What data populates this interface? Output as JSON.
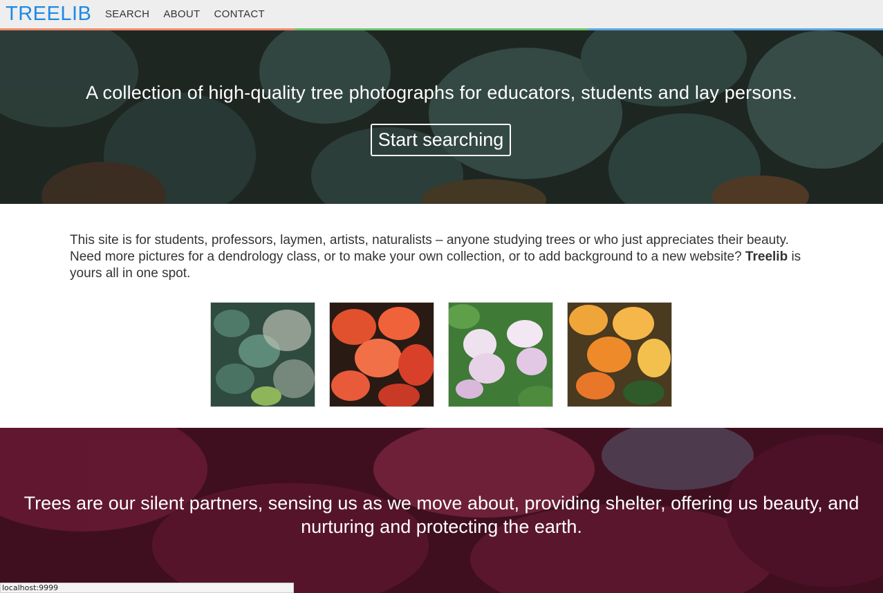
{
  "nav": {
    "logo": "TREELIB",
    "links": [
      {
        "label": "SEARCH"
      },
      {
        "label": "ABOUT"
      },
      {
        "label": "CONTACT"
      }
    ],
    "stripe_colors": [
      "#f08a6a",
      "#6cc26c",
      "#5ba6e0"
    ]
  },
  "hero": {
    "tagline": "A collection of high-quality tree photographs for educators, students and lay persons.",
    "cta_label": "Start searching"
  },
  "intro": {
    "text_before": "This site is for students, professors, laymen, artists, naturalists – anyone studying trees or who just appreciates their beauty. Need more pictures for a dendrology class, or to make your own collection, or to add background to a new website? ",
    "brand": "Treelib",
    "text_after": " is yours all in one spot."
  },
  "thumbnails": [
    {
      "name": "thumb-green-smoke-leaves"
    },
    {
      "name": "thumb-red-leaves"
    },
    {
      "name": "thumb-white-pink-flowers"
    },
    {
      "name": "thumb-orange-leaves"
    }
  ],
  "banner": {
    "quote": "Trees are our silent partners, sensing us as we move about, providing shelter, offering us beauty, and nurturing and protecting the earth."
  },
  "status_bar": {
    "url": "localhost:9999"
  },
  "colors": {
    "brand": "#1e88e5",
    "nav_bg": "#eeeeee",
    "hero_leaf": "#3f5c56",
    "banner_tone": "#6b1a33"
  }
}
